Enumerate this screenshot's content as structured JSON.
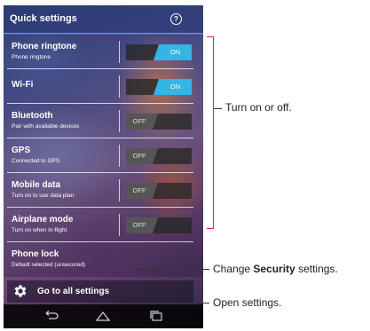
{
  "quick_settings": {
    "title": "Quick settings",
    "help_icon": "help-circle-icon",
    "help_glyph": "?"
  },
  "rows": [
    {
      "id": "phone-ringtone",
      "title": "Phone ringtone",
      "subtitle": "Phone ringtone",
      "toggle": "ON"
    },
    {
      "id": "wifi",
      "title": "Wi-Fi",
      "subtitle": "",
      "toggle": "ON"
    },
    {
      "id": "bluetooth",
      "title": "Bluetooth",
      "subtitle": "Pair with available devices",
      "toggle": "OFF"
    },
    {
      "id": "gps",
      "title": "GPS",
      "subtitle": "Connected to GPS",
      "toggle": "OFF"
    },
    {
      "id": "mobile-data",
      "title": "Mobile data",
      "subtitle": "Turn on to use data plan",
      "toggle": "OFF"
    },
    {
      "id": "airplane-mode",
      "title": "Airplane mode",
      "subtitle": "Turn on when in-flight",
      "toggle": "OFF"
    },
    {
      "id": "phone-lock",
      "title": "Phone lock",
      "subtitle": "Default selected (unsecured)",
      "toggle": ""
    }
  ],
  "settings_link": {
    "label": "Go to all settings",
    "icon": "gear-icon"
  },
  "navbar": {
    "icons": [
      "back-icon",
      "home-icon",
      "recent-apps-icon"
    ]
  },
  "callouts": {
    "toggles": "Turn on or off.",
    "security_prefix": "Change ",
    "security_bold": "Security",
    "security_suffix": " settings.",
    "settings": "Open settings."
  },
  "colors": {
    "accent": "#33b5e5",
    "bracket": "#e0245e",
    "toggle_track": "#282828",
    "toggle_off": "#5a5a5a"
  }
}
